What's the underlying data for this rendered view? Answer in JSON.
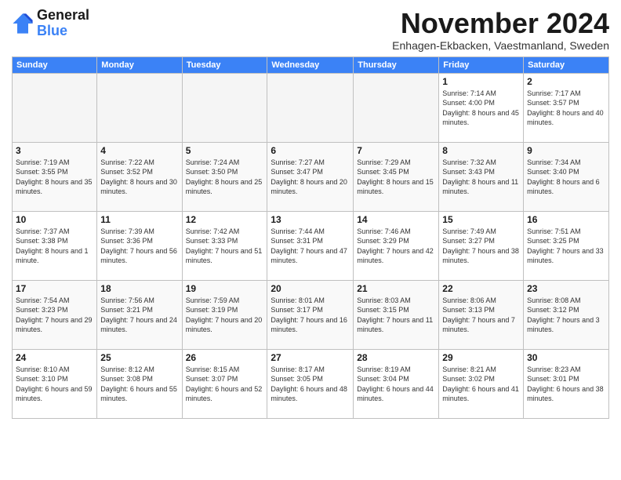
{
  "header": {
    "logo_line1": "General",
    "logo_line2": "Blue",
    "month": "November 2024",
    "location": "Enhagen-Ekbacken, Vaestmanland, Sweden"
  },
  "weekdays": [
    "Sunday",
    "Monday",
    "Tuesday",
    "Wednesday",
    "Thursday",
    "Friday",
    "Saturday"
  ],
  "weeks": [
    [
      {
        "day": "",
        "empty": true
      },
      {
        "day": "",
        "empty": true
      },
      {
        "day": "",
        "empty": true
      },
      {
        "day": "",
        "empty": true
      },
      {
        "day": "",
        "empty": true
      },
      {
        "day": "1",
        "rise": "Sunrise: 7:14 AM",
        "set": "Sunset: 4:00 PM",
        "daylight": "Daylight: 8 hours and 45 minutes."
      },
      {
        "day": "2",
        "rise": "Sunrise: 7:17 AM",
        "set": "Sunset: 3:57 PM",
        "daylight": "Daylight: 8 hours and 40 minutes."
      }
    ],
    [
      {
        "day": "3",
        "rise": "Sunrise: 7:19 AM",
        "set": "Sunset: 3:55 PM",
        "daylight": "Daylight: 8 hours and 35 minutes."
      },
      {
        "day": "4",
        "rise": "Sunrise: 7:22 AM",
        "set": "Sunset: 3:52 PM",
        "daylight": "Daylight: 8 hours and 30 minutes."
      },
      {
        "day": "5",
        "rise": "Sunrise: 7:24 AM",
        "set": "Sunset: 3:50 PM",
        "daylight": "Daylight: 8 hours and 25 minutes."
      },
      {
        "day": "6",
        "rise": "Sunrise: 7:27 AM",
        "set": "Sunset: 3:47 PM",
        "daylight": "Daylight: 8 hours and 20 minutes."
      },
      {
        "day": "7",
        "rise": "Sunrise: 7:29 AM",
        "set": "Sunset: 3:45 PM",
        "daylight": "Daylight: 8 hours and 15 minutes."
      },
      {
        "day": "8",
        "rise": "Sunrise: 7:32 AM",
        "set": "Sunset: 3:43 PM",
        "daylight": "Daylight: 8 hours and 11 minutes."
      },
      {
        "day": "9",
        "rise": "Sunrise: 7:34 AM",
        "set": "Sunset: 3:40 PM",
        "daylight": "Daylight: 8 hours and 6 minutes."
      }
    ],
    [
      {
        "day": "10",
        "rise": "Sunrise: 7:37 AM",
        "set": "Sunset: 3:38 PM",
        "daylight": "Daylight: 8 hours and 1 minute."
      },
      {
        "day": "11",
        "rise": "Sunrise: 7:39 AM",
        "set": "Sunset: 3:36 PM",
        "daylight": "Daylight: 7 hours and 56 minutes."
      },
      {
        "day": "12",
        "rise": "Sunrise: 7:42 AM",
        "set": "Sunset: 3:33 PM",
        "daylight": "Daylight: 7 hours and 51 minutes."
      },
      {
        "day": "13",
        "rise": "Sunrise: 7:44 AM",
        "set": "Sunset: 3:31 PM",
        "daylight": "Daylight: 7 hours and 47 minutes."
      },
      {
        "day": "14",
        "rise": "Sunrise: 7:46 AM",
        "set": "Sunset: 3:29 PM",
        "daylight": "Daylight: 7 hours and 42 minutes."
      },
      {
        "day": "15",
        "rise": "Sunrise: 7:49 AM",
        "set": "Sunset: 3:27 PM",
        "daylight": "Daylight: 7 hours and 38 minutes."
      },
      {
        "day": "16",
        "rise": "Sunrise: 7:51 AM",
        "set": "Sunset: 3:25 PM",
        "daylight": "Daylight: 7 hours and 33 minutes."
      }
    ],
    [
      {
        "day": "17",
        "rise": "Sunrise: 7:54 AM",
        "set": "Sunset: 3:23 PM",
        "daylight": "Daylight: 7 hours and 29 minutes."
      },
      {
        "day": "18",
        "rise": "Sunrise: 7:56 AM",
        "set": "Sunset: 3:21 PM",
        "daylight": "Daylight: 7 hours and 24 minutes."
      },
      {
        "day": "19",
        "rise": "Sunrise: 7:59 AM",
        "set": "Sunset: 3:19 PM",
        "daylight": "Daylight: 7 hours and 20 minutes."
      },
      {
        "day": "20",
        "rise": "Sunrise: 8:01 AM",
        "set": "Sunset: 3:17 PM",
        "daylight": "Daylight: 7 hours and 16 minutes."
      },
      {
        "day": "21",
        "rise": "Sunrise: 8:03 AM",
        "set": "Sunset: 3:15 PM",
        "daylight": "Daylight: 7 hours and 11 minutes."
      },
      {
        "day": "22",
        "rise": "Sunrise: 8:06 AM",
        "set": "Sunset: 3:13 PM",
        "daylight": "Daylight: 7 hours and 7 minutes."
      },
      {
        "day": "23",
        "rise": "Sunrise: 8:08 AM",
        "set": "Sunset: 3:12 PM",
        "daylight": "Daylight: 7 hours and 3 minutes."
      }
    ],
    [
      {
        "day": "24",
        "rise": "Sunrise: 8:10 AM",
        "set": "Sunset: 3:10 PM",
        "daylight": "Daylight: 6 hours and 59 minutes."
      },
      {
        "day": "25",
        "rise": "Sunrise: 8:12 AM",
        "set": "Sunset: 3:08 PM",
        "daylight": "Daylight: 6 hours and 55 minutes."
      },
      {
        "day": "26",
        "rise": "Sunrise: 8:15 AM",
        "set": "Sunset: 3:07 PM",
        "daylight": "Daylight: 6 hours and 52 minutes."
      },
      {
        "day": "27",
        "rise": "Sunrise: 8:17 AM",
        "set": "Sunset: 3:05 PM",
        "daylight": "Daylight: 6 hours and 48 minutes."
      },
      {
        "day": "28",
        "rise": "Sunrise: 8:19 AM",
        "set": "Sunset: 3:04 PM",
        "daylight": "Daylight: 6 hours and 44 minutes."
      },
      {
        "day": "29",
        "rise": "Sunrise: 8:21 AM",
        "set": "Sunset: 3:02 PM",
        "daylight": "Daylight: 6 hours and 41 minutes."
      },
      {
        "day": "30",
        "rise": "Sunrise: 8:23 AM",
        "set": "Sunset: 3:01 PM",
        "daylight": "Daylight: 6 hours and 38 minutes."
      }
    ]
  ]
}
